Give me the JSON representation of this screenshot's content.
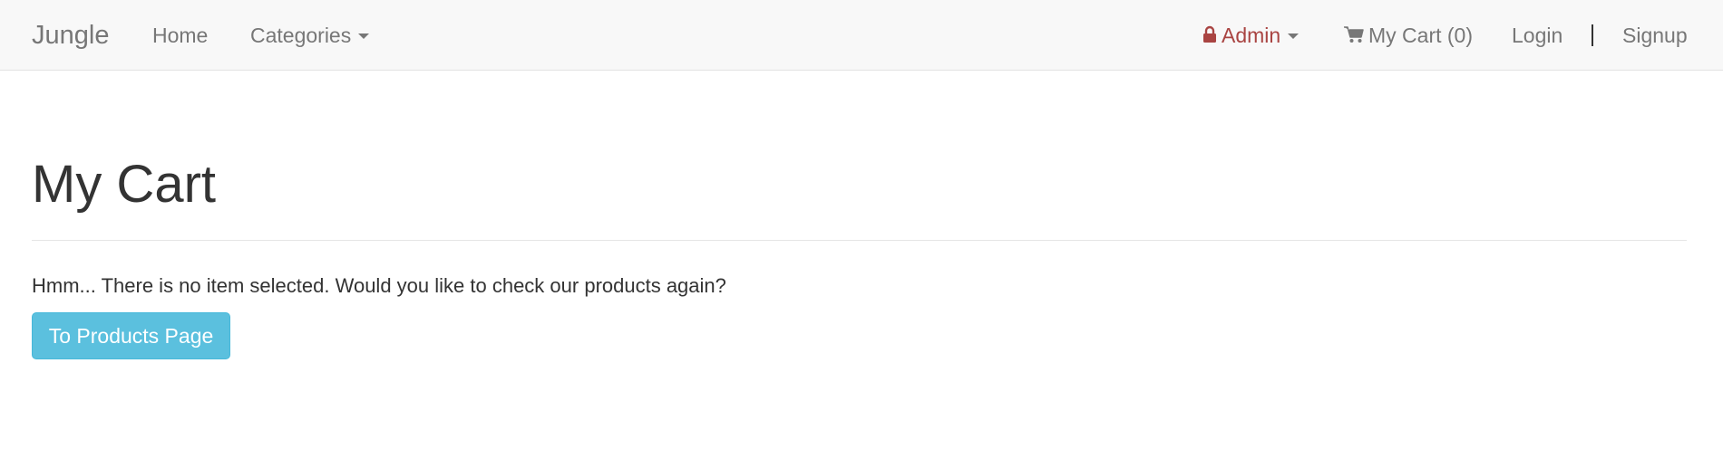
{
  "navbar": {
    "brand": "Jungle",
    "home": "Home",
    "categories": "Categories",
    "admin": "Admin",
    "cart": "My Cart (0)",
    "login": "Login",
    "signup": "Signup"
  },
  "main": {
    "title": "My Cart",
    "message": "Hmm... There is no item selected. Would you like to check our products again?",
    "button_label": "To Products Page"
  },
  "colors": {
    "navbar_bg": "#f8f8f8",
    "admin_red": "#a94442",
    "button_info": "#5bc0de"
  },
  "icons": {
    "admin": "lock-icon",
    "cart": "shopping-cart-icon",
    "dropdown": "caret-down-icon"
  }
}
